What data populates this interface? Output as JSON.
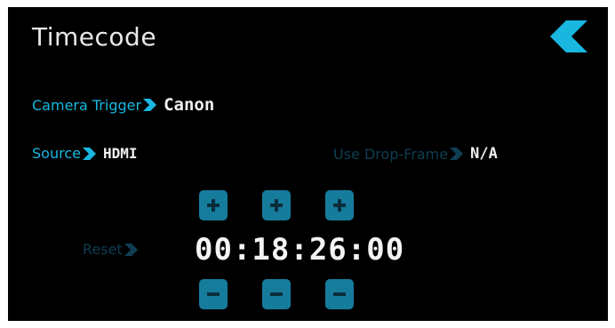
{
  "header": {
    "title": "Timecode",
    "back_icon": "back-arrow-icon"
  },
  "camera_trigger": {
    "label": "Camera Trigger",
    "value": "Canon"
  },
  "source": {
    "label": "Source",
    "value": "HDMI"
  },
  "drop_frame": {
    "label": "Use Drop-Frame",
    "value": "N/A"
  },
  "reset": {
    "label": "Reset"
  },
  "timecode": {
    "value": "00:18:26:00"
  },
  "controls": {
    "increment_icon": "plus-icon",
    "decrement_icon": "minus-icon"
  },
  "colors": {
    "accent": "#19b7e0",
    "button": "#167c9c",
    "dim_label": "#0f3e53",
    "background": "#000000"
  }
}
